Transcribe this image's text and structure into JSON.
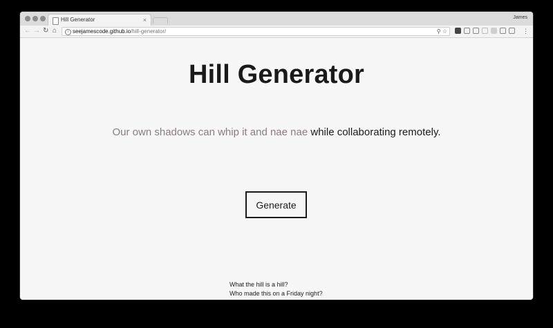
{
  "browser": {
    "tab_title": "Hill Generator",
    "tab_close": "×",
    "profile_name": "James",
    "url_host": "seejamescode.github.io",
    "url_path": "/hill-generator/"
  },
  "page": {
    "title": "Hill Generator",
    "sentence_dim": "Our own shadows can whip it and nae nae",
    "sentence_rest": " while collaborating remotely.",
    "generate_label": "Generate",
    "footer_links": [
      "What the hill is a hill?",
      "Who made this on a Friday night?"
    ]
  },
  "colors": {
    "dim_text": "#8a7a86",
    "text": "#1a1a1a",
    "background": "#f7f7f7"
  }
}
